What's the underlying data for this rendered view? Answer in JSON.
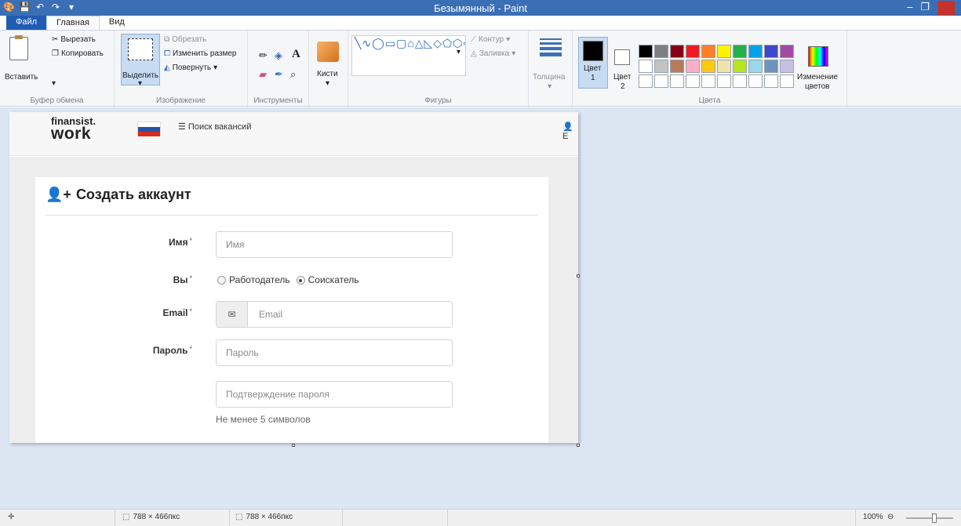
{
  "window": {
    "title": "Безымянный - Paint",
    "qat_icons": [
      "paint-app-icon",
      "save-icon",
      "undo-icon",
      "redo-icon",
      "qat-dropdown-icon"
    ]
  },
  "tabs": [
    {
      "label": "Файл"
    },
    {
      "label": "Главная"
    },
    {
      "label": "Вид"
    }
  ],
  "ribbon": {
    "clipboard": {
      "paste": "Вставить",
      "cut": "Вырезать",
      "copy": "Копировать",
      "group_label": "Буфер обмена"
    },
    "image": {
      "select": "Выделить",
      "crop": "Обрезать",
      "resize": "Изменить размер",
      "rotate": "Повернуть",
      "group_label": "Изображение"
    },
    "tools": {
      "group_label": "Инструменты",
      "items": [
        "pencil-icon",
        "fill-icon",
        "text-icon",
        "eraser-icon",
        "color-picker-icon",
        "magnifier-icon"
      ]
    },
    "brushes": "Кисти",
    "shapes": {
      "outline": "Контур",
      "fill": "Заливка",
      "group_label": "Фигуры",
      "glyphs": "╲∿◯▭▢⌂△◺◇⬠⬡⇨⇦⇧⇩✧☆✡▭◯◯"
    },
    "size": "Толщина",
    "colors": {
      "color1": "Цвет",
      "color1_num": "1",
      "color2": "Цвет",
      "color2_num": "2",
      "edit_line1": "Изменение",
      "edit_line2": "цветов",
      "group_label": "Цвета",
      "palette": [
        "#000000",
        "#7f7f7f",
        "#880015",
        "#ed1c24",
        "#ff7f27",
        "#fff200",
        "#22b14c",
        "#00a2e8",
        "#3f48cc",
        "#a349a4",
        "#ffffff",
        "#c3c3c3",
        "#b97a57",
        "#ffaec9",
        "#ffc90e",
        "#efe4b0",
        "#b5e61d",
        "#99d9ea",
        "#7092be",
        "#c8bfe7",
        "#ffffff",
        "#ffffff",
        "#ffffff",
        "#ffffff",
        "#ffffff",
        "#ffffff",
        "#ffffff",
        "#ffffff",
        "#ffffff",
        "#ffffff"
      ]
    }
  },
  "webpage": {
    "logo_top": "finansist.",
    "logo_bottom": "work",
    "nav_jobs": "Поиск вакансий",
    "user_initial": "E",
    "form_title": "Создать аккаунт",
    "fields": {
      "name_label": "Имя",
      "name_placeholder": "Имя",
      "role_label": "Вы",
      "role_employer": "Работодатель",
      "role_seeker": "Соискатель",
      "email_label": "Email",
      "email_placeholder": "Email",
      "password_label": "Пароль",
      "password_placeholder": "Пароль",
      "confirm_placeholder": "Подтверждение пароля",
      "password_hint": "Не менее 5 символов",
      "required_mark": "*"
    }
  },
  "statusbar": {
    "selection_size": "788 × 466пкс",
    "image_size": "788 × 466пкс",
    "zoom": "100%"
  }
}
